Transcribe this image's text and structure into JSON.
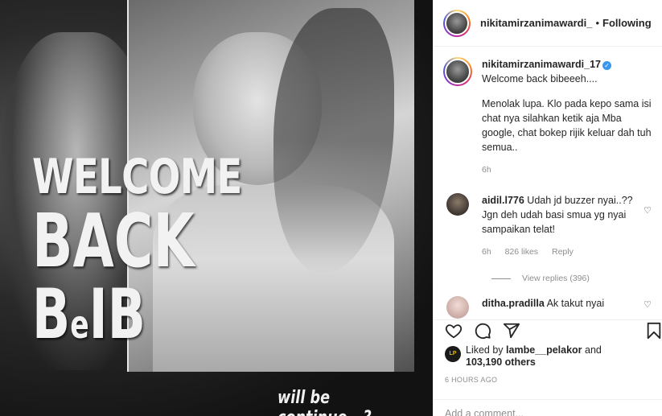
{
  "post_image": {
    "overlay_line1": "WELCOME",
    "overlay_line2": "BACK",
    "overlay_line3_a": "B",
    "overlay_line3_b": "e",
    "overlay_line3_c": "IB",
    "overlay_footer": "will be continue...?"
  },
  "header": {
    "username": "nikitamirzanimawardi_",
    "separator": "•",
    "follow_status": "Following"
  },
  "caption": {
    "username": "nikitamirzanimawardi_17",
    "verified_icon": "verified-badge-icon",
    "text_line1": "Welcome back bibeeeh....",
    "text_line2": "Menolak lupa. Klo pada kepo sama isi chat nya silahkan ketik aja Mba google, chat bokep rijik keluar dah tuh semua..",
    "time": "6h"
  },
  "comments": [
    {
      "username": "aidil.l776",
      "text": "Udah jd buzzer nyai..?? Jgn deh udah basi smua yg nyai sampaikan telat!",
      "time": "6h",
      "likes": "826 likes",
      "reply": "Reply",
      "view_replies": "View replies (396)"
    },
    {
      "username": "ditha.pradilla",
      "text": "Ak takut nyai"
    }
  ],
  "actions": {
    "like_icon": "heart-icon",
    "comment_icon": "comment-icon",
    "share_icon": "share-icon",
    "save_icon": "bookmark-icon"
  },
  "likes": {
    "prefix": "Liked by",
    "user": "lambe__pelakor",
    "mid": "and",
    "count": "103,190 others",
    "avatar_label": "LP"
  },
  "timestamp": "6 HOURS AGO",
  "add_comment_placeholder": "Add a comment..."
}
